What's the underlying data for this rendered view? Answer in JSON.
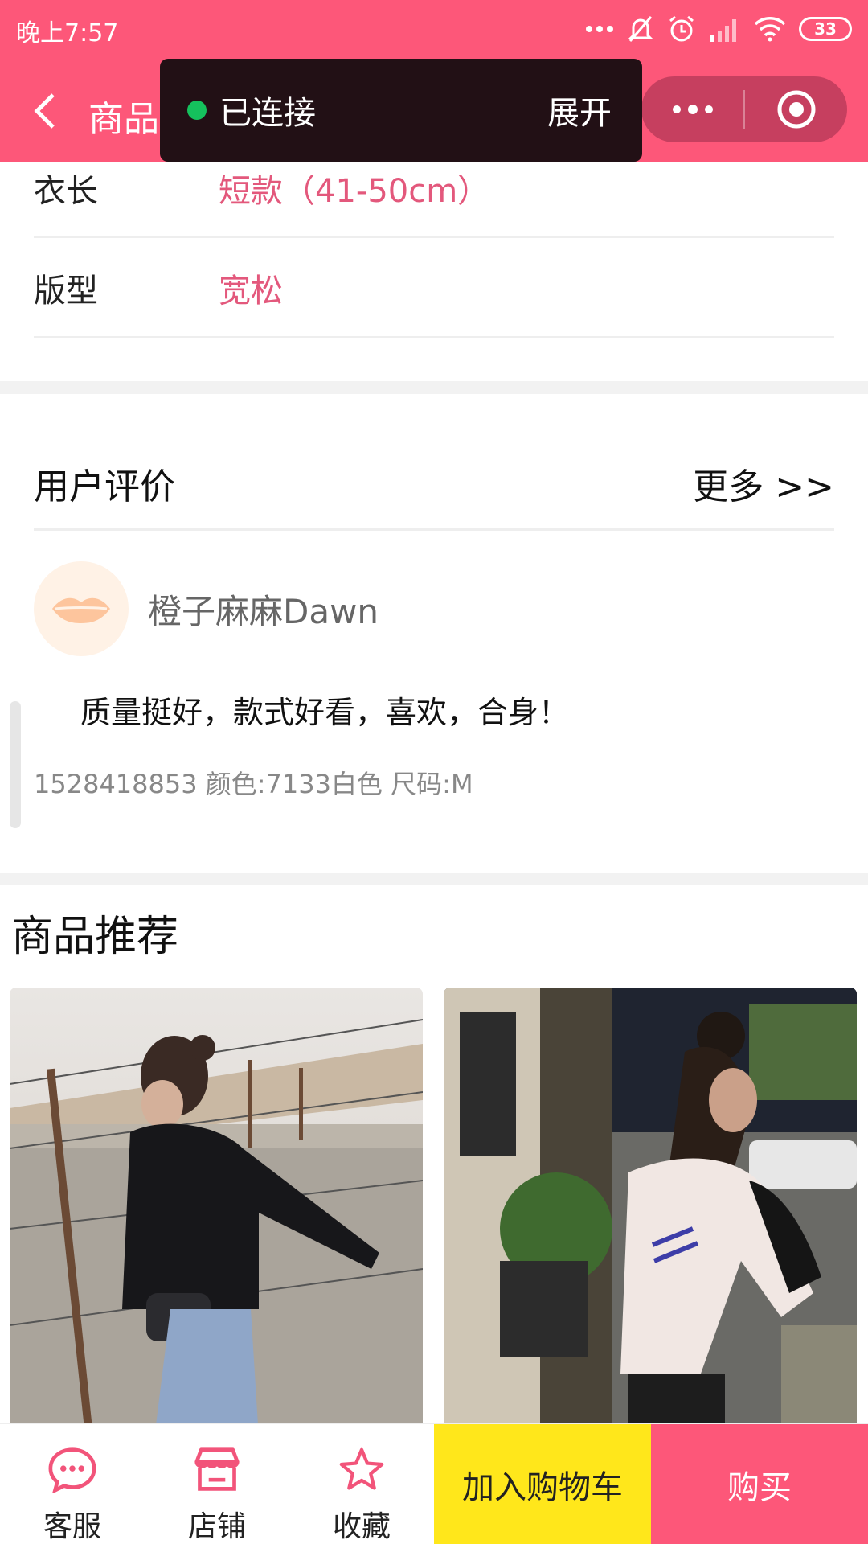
{
  "status_bar": {
    "time": "晚上7:57",
    "battery": "33"
  },
  "nav": {
    "title": "商品详情"
  },
  "connection_toast": {
    "status": "已连接",
    "expand": "展开"
  },
  "specs": [
    {
      "label": "衣长",
      "value": "短款（41-50cm）"
    },
    {
      "label": "版型",
      "value": "宽松"
    }
  ],
  "reviews": {
    "title": "用户评价",
    "more": "更多 >>",
    "items": [
      {
        "user": "橙子麻麻Dawn",
        "content": "质量挺好，款式好看，喜欢，合身！",
        "meta": "1528418853 颜色:7133白色 尺码:M"
      }
    ]
  },
  "recommendations": {
    "title": "商品推荐"
  },
  "bottom_bar": {
    "service": "客服",
    "shop": "店铺",
    "favorite": "收藏",
    "add_to_cart": "加入购物车",
    "buy": "购买"
  },
  "colors": {
    "brand_pink": "#fd5779",
    "spec_value": "#e3587c",
    "cart_yellow": "#ffe71b"
  }
}
